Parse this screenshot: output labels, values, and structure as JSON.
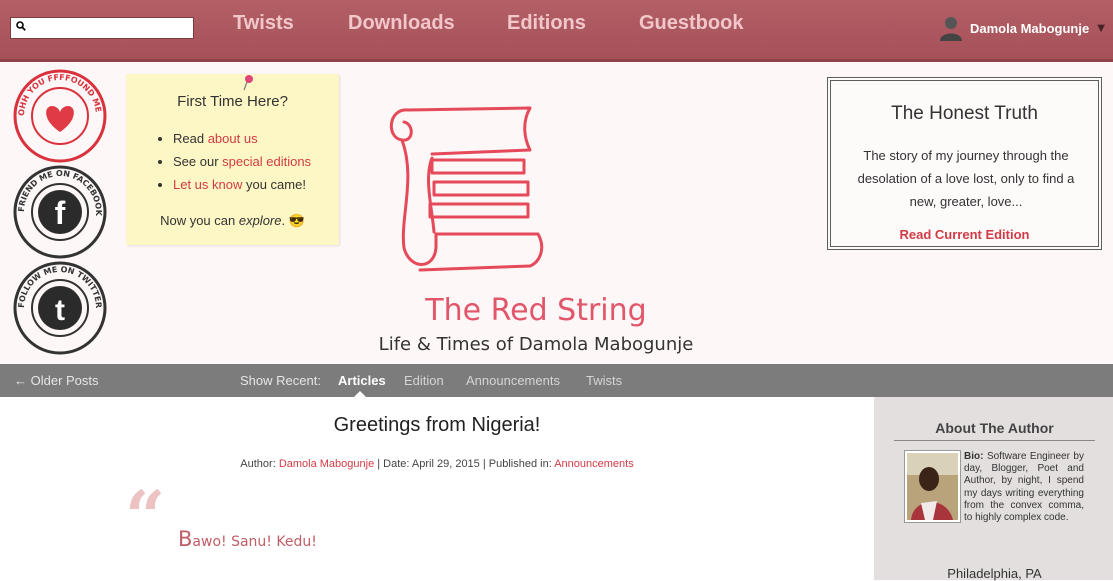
{
  "nav": {
    "search": {
      "value": "",
      "placeholder": ""
    },
    "links": [
      "Twists",
      "Downloads",
      "Editions",
      "Guestbook"
    ],
    "user_name": "Damola Mabogunje"
  },
  "stamps": [
    {
      "text": "OHH YOU FFFFOUND ME",
      "icon": "heart-icon"
    },
    {
      "text": "FRIEND ME ON FACEBOOK",
      "icon": "facebook-icon"
    },
    {
      "text": "FOLLOW ME ON TWITTER",
      "icon": "twitter-icon"
    }
  ],
  "first_time": {
    "title": "First Time Here?",
    "items": [
      {
        "pre": "Read ",
        "link": "about us",
        "post": ""
      },
      {
        "pre": "See our ",
        "link": "special editions",
        "post": ""
      },
      {
        "pre": "",
        "link": "Let us know",
        "post": " you came!"
      }
    ],
    "footer_pre": "Now you can ",
    "footer_em": "explore",
    "footer_post": ". 😎"
  },
  "site": {
    "title": "The Red String",
    "subtitle": "Life & Times of Damola Mabogunje"
  },
  "honest": {
    "title": "The Honest Truth",
    "body": "The story of my journey through the desolation of a love lost, only to find a new, greater, love...",
    "link": "Read Current Edition"
  },
  "subnav": {
    "older": "← Older Posts",
    "show_recent": "Show Recent:",
    "tabs": [
      "Articles",
      "Edition",
      "Announcements",
      "Twists"
    ],
    "active": "Articles"
  },
  "post": {
    "title": "Greetings from Nigeria!",
    "meta_author_label": "Author: ",
    "author": "Damola Mabogunje",
    "meta_date": " | Date: April 29, 2015 | Published in: ",
    "category": "Announcements",
    "quote_mark": "“",
    "greeting_first": "B",
    "greeting_rest": "awo! Sanu! Kedu!"
  },
  "sidebar": {
    "title": "About The Author",
    "bio_label": "Bio:",
    "bio": " Software Engineer by day, Blogger, Poet and Author, by night, I spend my days writing everything from the convex comma, to highly complex code.",
    "location": "Philadelphia, PA"
  },
  "colors": {
    "nav_bg": "#a65159",
    "accent": "#d23b46",
    "title_pink": "#e2566a",
    "subnav_bg": "#7c7c7c"
  }
}
